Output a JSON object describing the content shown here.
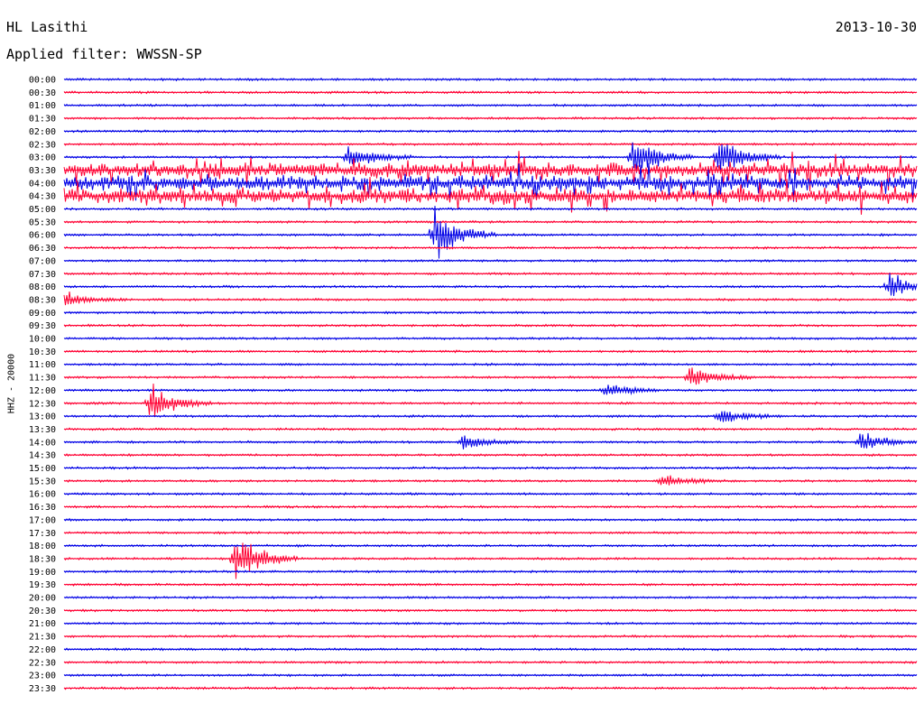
{
  "header": {
    "station": "HL Lasithi",
    "date": "2013-10-30",
    "filter": "Applied filter: WWSSN-SP"
  },
  "colors": {
    "blue": "#0000e6",
    "red": "#ff0033"
  },
  "chart_data": {
    "type": "line",
    "title": "HL Lasithi",
    "ylabel": "HHZ - 20000",
    "trace_colors_alternate": [
      "blue",
      "red"
    ],
    "rows": [
      "00:00",
      "00:30",
      "01:00",
      "01:30",
      "02:00",
      "02:30",
      "03:00",
      "03:30",
      "04:00",
      "04:30",
      "05:00",
      "05:30",
      "06:00",
      "06:30",
      "07:00",
      "07:30",
      "08:00",
      "08:30",
      "09:00",
      "09:30",
      "10:00",
      "10:30",
      "11:00",
      "11:30",
      "12:00",
      "12:30",
      "13:00",
      "13:30",
      "14:00",
      "14:30",
      "15:00",
      "15:30",
      "16:00",
      "16:30",
      "17:00",
      "17:30",
      "18:00",
      "18:30",
      "19:00",
      "19:30",
      "20:00",
      "20:30",
      "21:00",
      "21:30",
      "22:00",
      "22:30",
      "23:00",
      "23:30"
    ],
    "events": [
      {
        "row": "03:00",
        "minute": 10,
        "amplitude": 0.9
      },
      {
        "row": "03:00",
        "minute": 20,
        "amplitude": 1.3
      },
      {
        "row": "03:00",
        "minute": 23,
        "amplitude": 1.2
      },
      {
        "row": "06:00",
        "minute": 13,
        "amplitude": 1.4
      },
      {
        "row": "08:00",
        "minute": 29,
        "amplitude": 0.8
      },
      {
        "row": "08:30",
        "minute": 0,
        "amplitude": 0.4
      },
      {
        "row": "11:30",
        "minute": 22,
        "amplitude": 0.7
      },
      {
        "row": "12:00",
        "minute": 19,
        "amplitude": 0.4
      },
      {
        "row": "12:30",
        "minute": 3,
        "amplitude": 1.0
      },
      {
        "row": "13:00",
        "minute": 23,
        "amplitude": 0.5
      },
      {
        "row": "14:00",
        "minute": 14,
        "amplitude": 0.4
      },
      {
        "row": "14:00",
        "minute": 28,
        "amplitude": 0.6
      },
      {
        "row": "15:30",
        "minute": 21,
        "amplitude": 0.4
      },
      {
        "row": "18:30",
        "minute": 6,
        "amplitude": 1.4
      }
    ]
  }
}
